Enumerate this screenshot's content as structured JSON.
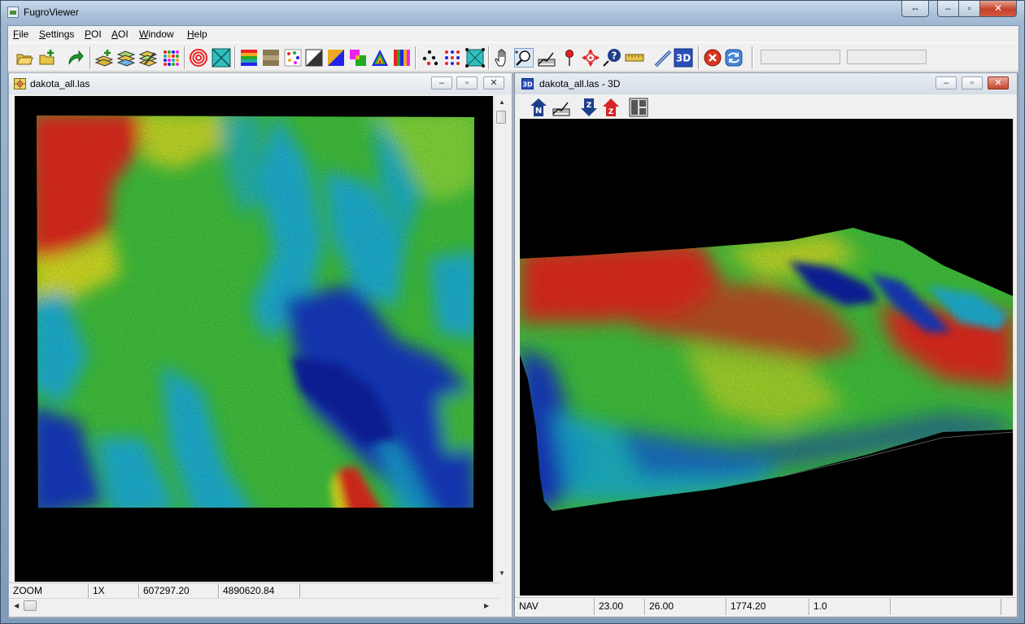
{
  "app": {
    "title": "FugroViewer"
  },
  "menu": [
    "File",
    "Settings",
    "POI",
    "AOI",
    "Window",
    "Help"
  ],
  "toolbar": {
    "icons": [
      "open-file-icon",
      "add-file-icon",
      "redo-arrow-icon",
      "add-layer-icon",
      "layers-icon",
      "layers-edit-icon",
      "color-grid-icon",
      "contour-icon",
      "tin-icon",
      "elevation-ramp-icon",
      "intensity-icon",
      "rgb-points-icon",
      "hillshade-icon",
      "classification-icon",
      "return-icon",
      "spectrum-icon",
      "rainbow-bars-icon",
      "points-icon",
      "point-grid-icon",
      "surface-icon",
      "pan-hand-icon",
      "zoom-icon",
      "profile-icon",
      "pin-icon",
      "crosshair-icon",
      "query-icon",
      "ruler-icon",
      "measure-line-icon",
      "3d-icon",
      "cancel-icon",
      "refresh-icon"
    ],
    "three_d_label": "3D"
  },
  "left_window": {
    "title": "dakota_all.las",
    "status": {
      "mode": "ZOOM",
      "zoom": "1X",
      "x": "607297.20",
      "y": "4890620.84"
    }
  },
  "right_window": {
    "title": "dakota_all.las - 3D",
    "icon_label": "3D",
    "subtoolbar": [
      "north-up-icon",
      "profile-view-icon",
      "z-down-icon",
      "z-up-icon",
      "split-view-icon"
    ],
    "z_label": "Z",
    "n_label": "N",
    "status": {
      "mode": "NAV",
      "v1": "23.00",
      "v2": "26.00",
      "v3": "1774.20",
      "v4": "1.0"
    }
  },
  "colors": {
    "red": "#d8261b",
    "green": "#3fb83a",
    "blue": "#1435b8",
    "cyan": "#1aa7c9",
    "yellow": "#d9d51f"
  }
}
